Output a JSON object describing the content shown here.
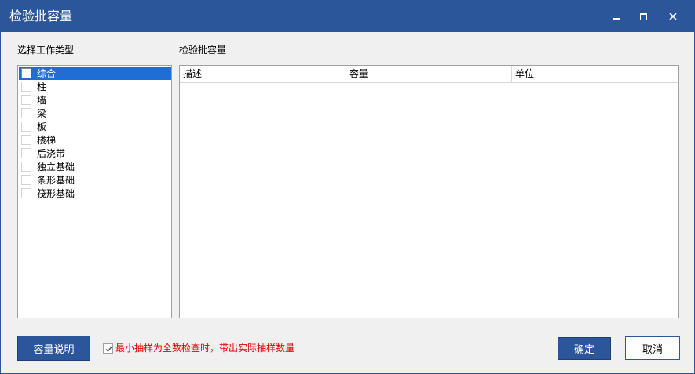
{
  "window": {
    "title": "检验批容量"
  },
  "left_panel": {
    "label": "选择工作类型",
    "items": [
      {
        "label": "综合",
        "checked": false,
        "selected": true
      },
      {
        "label": "柱",
        "checked": false,
        "selected": false
      },
      {
        "label": "墙",
        "checked": false,
        "selected": false
      },
      {
        "label": "梁",
        "checked": false,
        "selected": false
      },
      {
        "label": "板",
        "checked": false,
        "selected": false
      },
      {
        "label": "楼梯",
        "checked": false,
        "selected": false
      },
      {
        "label": "后浇带",
        "checked": false,
        "selected": false
      },
      {
        "label": "独立基础",
        "checked": false,
        "selected": false
      },
      {
        "label": "条形基础",
        "checked": false,
        "selected": false
      },
      {
        "label": "筏形基础",
        "checked": false,
        "selected": false
      }
    ]
  },
  "right_panel": {
    "label": "检验批容量",
    "columns": [
      "描述",
      "容量",
      "单位"
    ],
    "rows": []
  },
  "footer": {
    "explain_button": "容量说明",
    "option_label": "最小抽样为全数检查时，带出实际抽样数量",
    "option_checked": true,
    "ok_button": "确定",
    "cancel_button": "取消"
  },
  "colors": {
    "accent": "#2b579a",
    "selection": "#1e6ed6",
    "warning_text": "#e00000"
  }
}
